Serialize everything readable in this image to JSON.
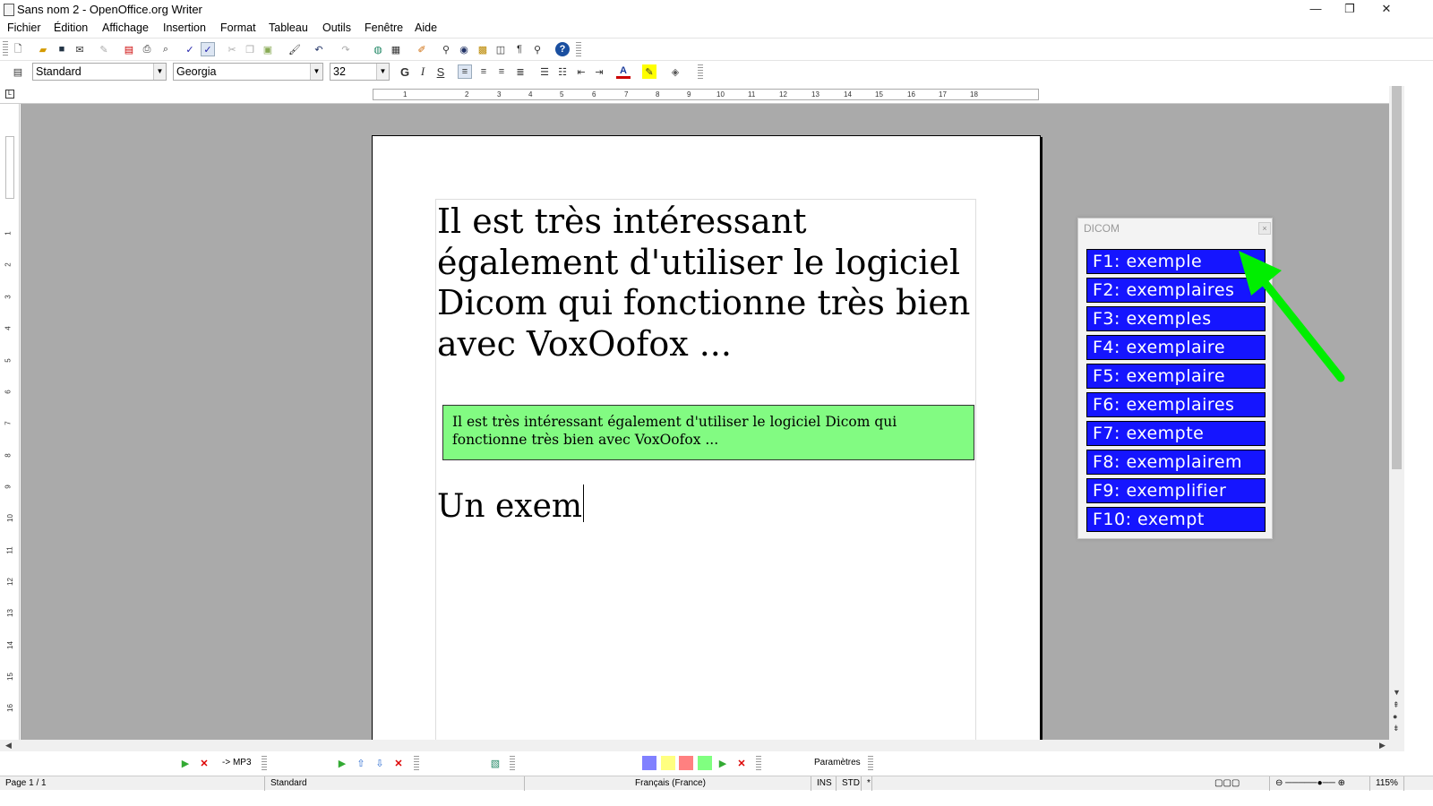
{
  "window": {
    "title": "Sans nom 2 - OpenOffice.org Writer",
    "minimize": "—",
    "restore": "❐",
    "close": "✕"
  },
  "menu": [
    "Fichier",
    "Édition",
    "Affichage",
    "Insertion",
    "Format",
    "Tableau",
    "Outils",
    "Fenêtre",
    "Aide"
  ],
  "formatting": {
    "style": "Standard",
    "font": "Georgia",
    "size": "32",
    "bold": "G",
    "italic": "I",
    "underline": "S"
  },
  "ruler": {
    "ticks": [
      "1",
      "2",
      "3",
      "4",
      "5",
      "6",
      "7",
      "8",
      "9",
      "10",
      "11",
      "12",
      "13",
      "14",
      "15",
      "16",
      "17",
      "18"
    ],
    "vticks": [
      "1",
      "2",
      "3",
      "4",
      "5",
      "6",
      "7",
      "8",
      "9",
      "10",
      "11",
      "12",
      "13",
      "14",
      "15",
      "16"
    ]
  },
  "document": {
    "para1": "Il est très intéressant également d'utiliser le logiciel Dicom qui fonctionne très bien avec VoxOofox ...",
    "box_text": "Il est très intéressant également d'utiliser le logiciel Dicom qui fonctionne très bien avec VoxOofox ...",
    "para2": "Un exem"
  },
  "dicom": {
    "title": "DICOM",
    "close": "×",
    "items": [
      "F1: exemple",
      "F2: exemplaires",
      "F3: exemples",
      "F4: exemplaire",
      "F5: exemplaire",
      "F6: exemplaires",
      "F7: exempte",
      "F8: exemplairem",
      "F9: exemplifier",
      "F10: exempt"
    ]
  },
  "bottom_toolbar": {
    "mp3": "-> MP3",
    "params": "Paramètres"
  },
  "status": {
    "page": "Page 1 / 1",
    "style": "Standard",
    "language": "Français (France)",
    "ins": "INS",
    "std": "STD",
    "zoom": "115%"
  },
  "colors": {
    "dicom_item": "#1515ff",
    "highlight": "#82fb82",
    "arrow": "#00ee00"
  }
}
